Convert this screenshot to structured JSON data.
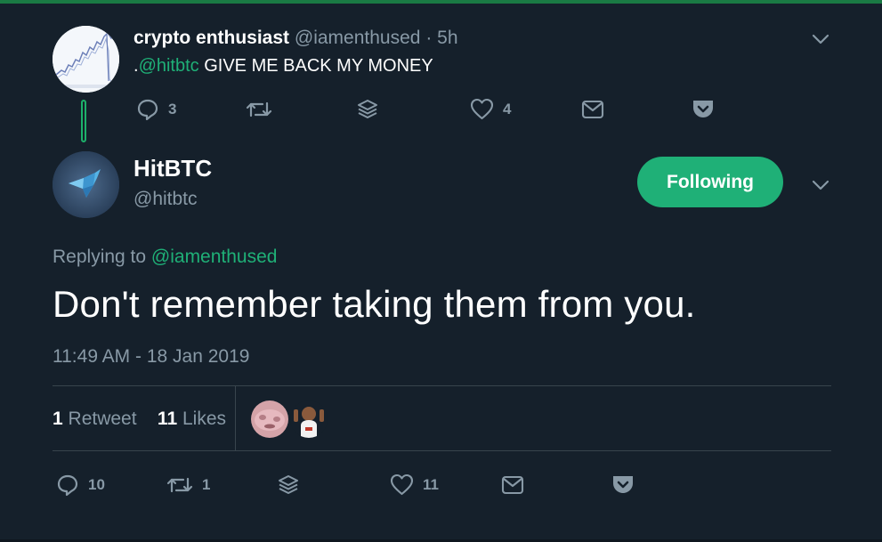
{
  "parent_tweet": {
    "name": "crypto enthusiast",
    "handle": "@iamenthused",
    "dot": "·",
    "time": "5h",
    "text_prefix": ".",
    "text_mention": "@hitbtc",
    "text_body": " GIVE ME BACK MY MONEY",
    "actions": {
      "reply_count": "3",
      "retweet_count": "",
      "like_count": "4"
    }
  },
  "main_tweet": {
    "name": "HitBTC",
    "handle": "@hitbtc",
    "follow_label": "Following",
    "replying_prefix": "Replying to ",
    "replying_to": "@iamenthused",
    "text": "Don't remember taking them from you.",
    "timestamp": "11:49 AM - 18 Jan 2019",
    "stats": {
      "retweets_count": "1",
      "retweets_label": "Retweet",
      "likes_count": "11",
      "likes_label": "Likes"
    },
    "actions": {
      "reply_count": "10",
      "retweet_count": "1",
      "like_count": "11"
    }
  },
  "colors": {
    "background": "#15202b",
    "accent": "#1fb077",
    "secondary_text": "#8899a6",
    "divider": "#38444d"
  },
  "icons": [
    "reply-icon",
    "retweet-icon",
    "stack-icon",
    "heart-icon",
    "envelope-icon",
    "pocket-icon",
    "chevron-down-icon"
  ]
}
